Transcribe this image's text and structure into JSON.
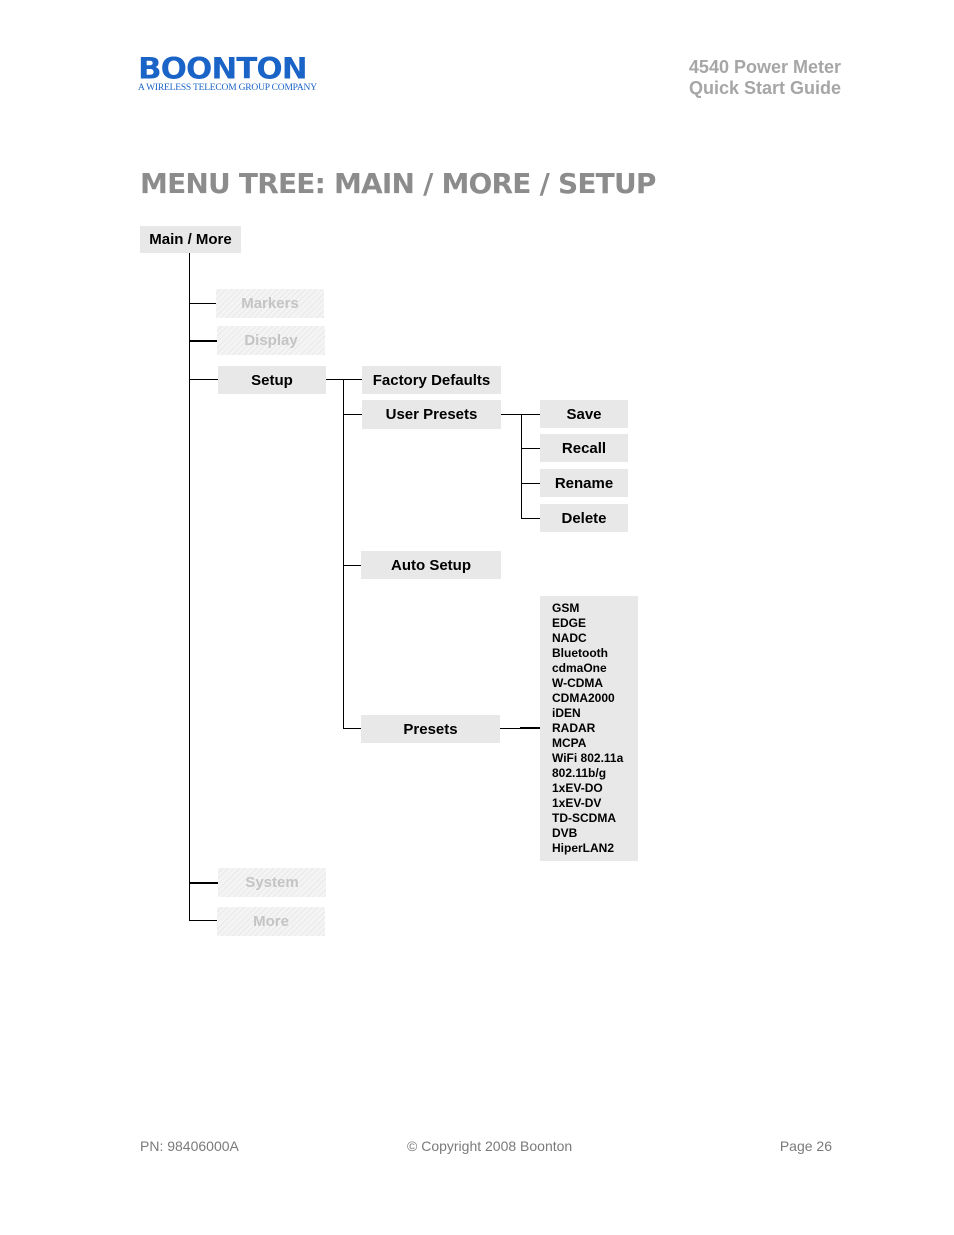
{
  "header": {
    "logo_name": "BOONTON",
    "logo_tagline": "A WIRELESS TELECOM GROUP COMPANY",
    "doc_title_line1": "4540 Power Meter",
    "doc_title_line2": "Quick Start Guide"
  },
  "page_title": "MENU TREE:  MAIN / MORE / SETUP",
  "tree": {
    "root": "Main / More",
    "level1": [
      {
        "label": "Markers",
        "enabled": false
      },
      {
        "label": "Display",
        "enabled": false
      },
      {
        "label": "Setup",
        "enabled": true
      },
      {
        "label": "System",
        "enabled": false
      },
      {
        "label": "More",
        "enabled": false
      }
    ],
    "setup_children": [
      "Factory Defaults",
      "User Presets",
      "Auto Setup",
      "Presets"
    ],
    "user_presets_children": [
      "Save",
      "Recall",
      "Rename",
      "Delete"
    ],
    "presets_list": [
      "GSM",
      "EDGE",
      "NADC",
      "Bluetooth",
      "cdmaOne",
      "W-CDMA",
      "CDMA2000",
      "iDEN",
      "RADAR",
      "MCPA",
      "WiFi 802.11a",
      "802.11b/g",
      "1xEV-DO",
      "1xEV-DV",
      "TD-SCDMA",
      "DVB",
      "HiperLAN2"
    ]
  },
  "footer": {
    "part_number": "PN: 98406000A",
    "copyright": "© Copyright 2008 Boonton",
    "page": "Page 26"
  },
  "colors": {
    "brand_blue": "#1a64c8",
    "title_gray": "#8c8c8c",
    "box_fill": "#e8e8e8"
  }
}
